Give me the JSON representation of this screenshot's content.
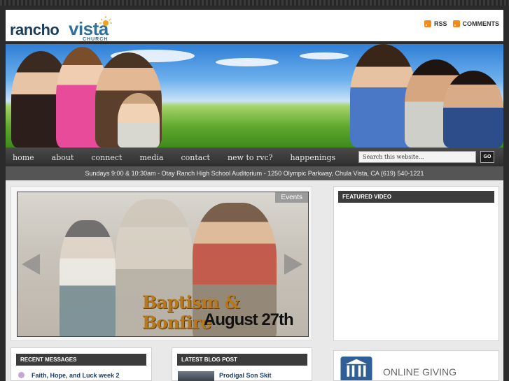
{
  "header": {
    "logo_rancho": "rancho",
    "logo_vista": "vista",
    "logo_church": "CHURCH",
    "rss_label": "RSS",
    "comments_label": "COMMENTS"
  },
  "nav": {
    "items": [
      "home",
      "about",
      "connect",
      "media",
      "contact",
      "new to rvc?",
      "happenings"
    ],
    "search_placeholder": "Search this website...",
    "go_label": "GO"
  },
  "info_bar": "Sundays 9:00 & 10:30am - Otay Ranch High School Auditorium - 1250 Olympic Parkway, Chula Vista, CA (619) 540-1221",
  "slider": {
    "tag": "Events",
    "title": "Baptism & Bonfire",
    "date": "August 27th"
  },
  "featured_video": {
    "heading": "FEATURED VIDEO"
  },
  "recent_messages": {
    "heading": "RECENT MESSAGES",
    "item": "Faith, Hope, and Luck week 2"
  },
  "latest_blog": {
    "heading": "LATEST BLOG POST",
    "item": "Prodigal Son Skit"
  },
  "giving": {
    "label": "ONLINE GIVING"
  },
  "colors": {
    "nav_bg": "#3a3a3a",
    "accent_orange": "#f28a1c",
    "logo_blue": "#2f6f9a",
    "link_blue": "#1d3d73"
  }
}
